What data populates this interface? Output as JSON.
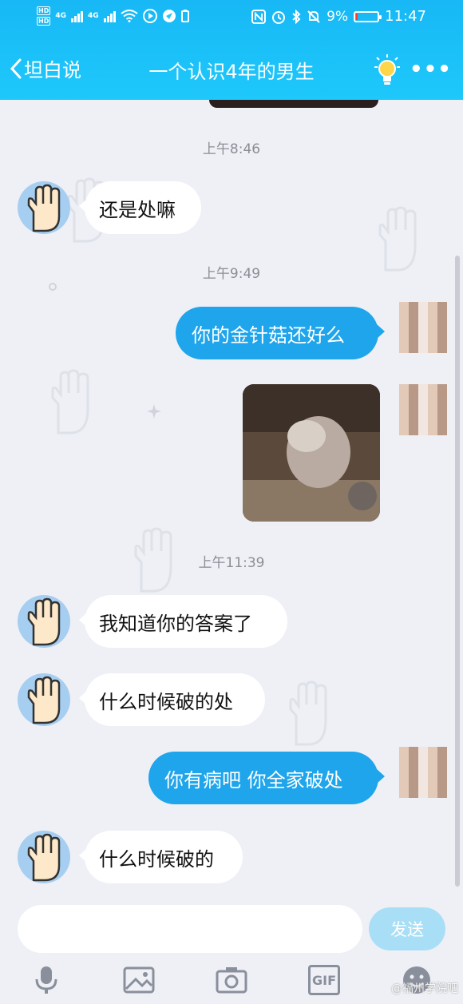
{
  "status_bar": {
    "hd1": "HD",
    "hd2": "HD",
    "net1": "4G",
    "net2": "4G",
    "battery_percent": "9%",
    "battery_level": 0.09,
    "time": "11:47"
  },
  "header": {
    "back_label": "坦白说",
    "title": "一个认识4年的男生",
    "right_icons": [
      "lightbulb-icon",
      "more-icon"
    ]
  },
  "messages": {
    "time1": "上午8:46",
    "msg1": "还是处嘛",
    "time2": "上午9:49",
    "msg2": "你的金针菇还好么",
    "time3": "上午11:39",
    "msg3": "我知道你的答案了",
    "msg4": "什么时候破的处",
    "msg5": "你有病吧 你全家破处",
    "msg6": "什么时候破的"
  },
  "input": {
    "value": "",
    "send_label": "发送"
  },
  "toolbar": {
    "icons": [
      "microphone-icon",
      "image-icon",
      "camera-icon",
      "gif-icon",
      "emoji-icon"
    ],
    "gif_label": "GIF"
  },
  "watermark": "@福州学院吧",
  "colors": {
    "header": "#1ec8fb",
    "outgoing_bubble": "#1ea5ec",
    "incoming_bubble": "#ffffff",
    "background": "#eef0f6",
    "send_button": "#a9dff6"
  }
}
